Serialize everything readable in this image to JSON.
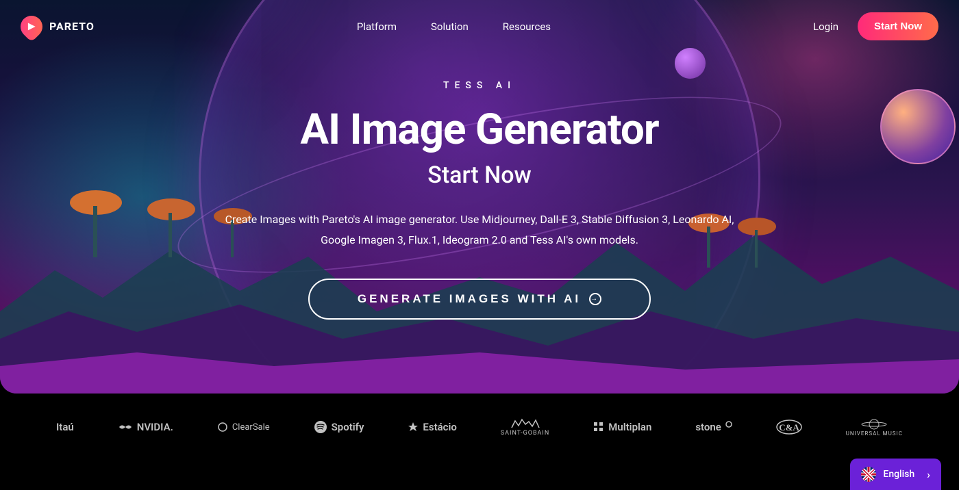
{
  "header": {
    "logo_text": "PARETO",
    "nav": {
      "platform": "Platform",
      "solution": "Solution",
      "resources": "Resources"
    },
    "login": "Login",
    "start_now": "Start Now"
  },
  "hero": {
    "eyebrow": "TESS AI",
    "title": "AI Image Generator",
    "subtitle": "Start Now",
    "description": "Create Images with Pareto's AI image generator. Use Midjourney, Dall-E 3, Stable Diffusion 3, Leonardo AI, Google Imagen 3, Flux.1, Ideogram 2.0 and Tess AI's own models.",
    "cta_label": "GENERATE IMAGES WITH AI"
  },
  "logos": {
    "items": [
      "Itaú",
      "NVIDIA.",
      "ClearSale",
      "Spotify",
      "Estácio",
      "SAINT-GOBAIN",
      "Multiplan",
      "stone",
      "C&A",
      "UNIVERSAL MUSIC"
    ]
  },
  "lang": {
    "label": "English"
  }
}
